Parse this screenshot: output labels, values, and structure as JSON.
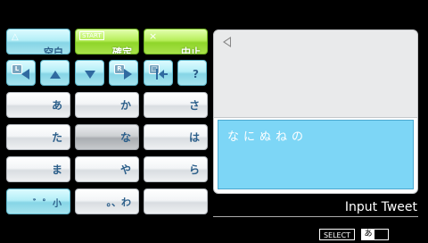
{
  "keys": {
    "row1": {
      "space": "空白",
      "space_tag": "△",
      "confirm": "確定",
      "confirm_tag": "START",
      "cancel": "中止",
      "cancel_tag": "×"
    },
    "row2": {
      "l_tag": "L",
      "r_tag": "R",
      "bs_tag": "□",
      "help": "?"
    },
    "kana": [
      [
        "あ",
        "か",
        "さ"
      ],
      [
        "た",
        "な",
        "は"
      ],
      [
        "ま",
        "や",
        "ら"
      ],
      [
        "゛゜小",
        "。、わ",
        ""
      ]
    ]
  },
  "input": {
    "text": "なにぬねの"
  },
  "mode_label": "Input Tweet",
  "footer": {
    "select": "SELECT",
    "mode": "あ"
  },
  "colors": {
    "accent_cyan": "#b3eef7",
    "accent_green": "#a9e24a",
    "input_bg": "#7dd6f6"
  }
}
